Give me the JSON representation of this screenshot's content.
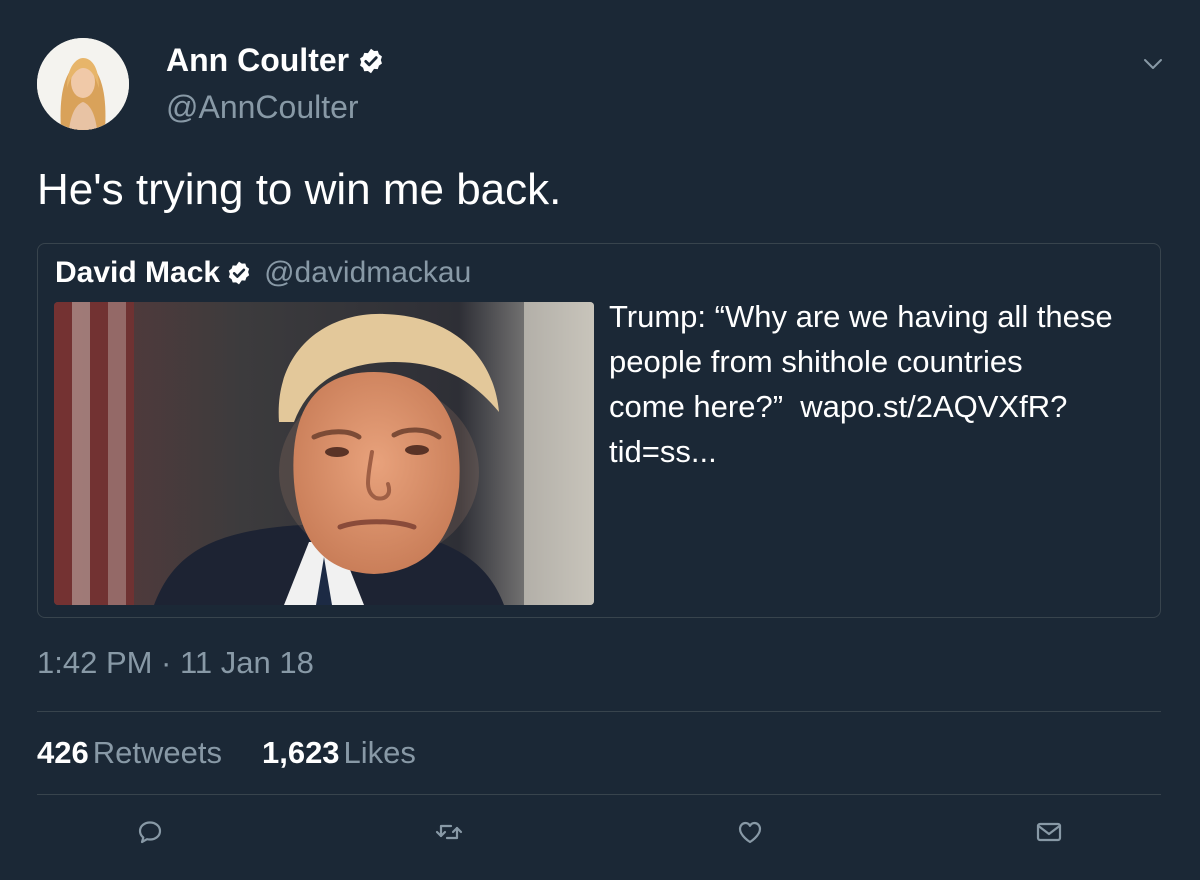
{
  "tweet": {
    "author": {
      "name": "Ann Coulter",
      "handle": "@AnnCoulter",
      "verified": true
    },
    "text": "He's trying to win me back.",
    "quoted": {
      "author_name": "David Mack",
      "author_handle": "@davidmackau",
      "verified": true,
      "text_line1": "Trump: “Why are we having all these",
      "text_line2": "people from shithole countries",
      "text_line3_before_link": "come here?”  ",
      "link": "wapo.st/2AQVXfR?",
      "text_line4": "tid=ss..."
    },
    "timestamp": "1:42 PM · 11 Jan 18",
    "stats": {
      "retweets_count": "426",
      "retweets_label": "Retweets",
      "likes_count": "1,623",
      "likes_label": "Likes"
    }
  },
  "icons": {
    "verified": "verified-badge-icon",
    "caret": "chevron-down-icon",
    "reply": "reply-icon",
    "retweet": "retweet-icon",
    "like": "heart-icon",
    "message": "envelope-icon"
  },
  "colors": {
    "background": "#1b2836",
    "text_primary": "#ffffff",
    "text_secondary": "#8899a6",
    "border": "#38444d"
  }
}
